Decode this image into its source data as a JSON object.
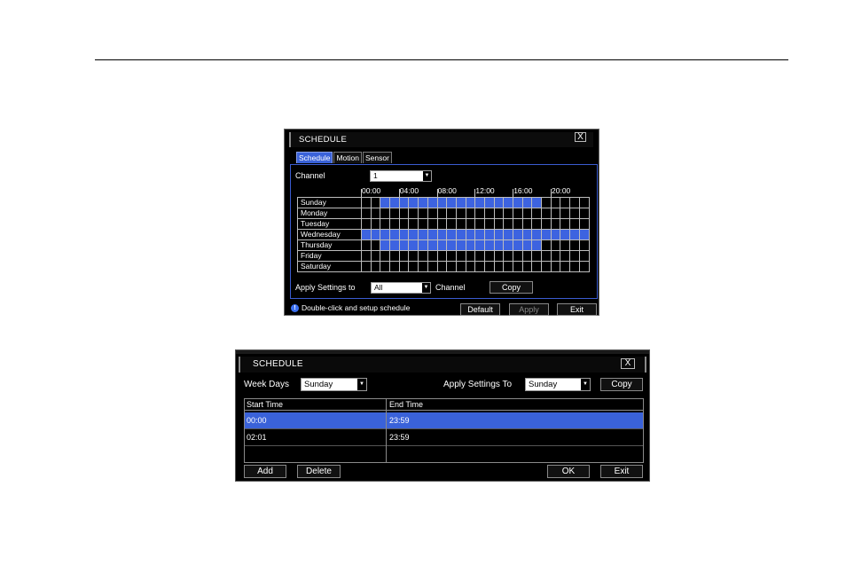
{
  "dialog1": {
    "title": "SCHEDULE",
    "close_glyph": "X",
    "tabs": [
      "Schedule",
      "Motion",
      "Sensor"
    ],
    "active_tab": "Schedule",
    "channel_label": "Channel",
    "channel_value": "1",
    "hours": [
      "00:00",
      "04:00",
      "08:00",
      "12:00",
      "16:00",
      "20:00"
    ],
    "days": [
      "Sunday",
      "Monday",
      "Tuesday",
      "Wednesday",
      "Thursday",
      "Friday",
      "Saturday"
    ],
    "schedule_blocks": [
      [
        2,
        19
      ],
      null,
      null,
      [
        0,
        24
      ],
      [
        2,
        19
      ],
      null,
      null
    ],
    "apply_label": "Apply Settings to",
    "apply_value": "All",
    "apply_suffix": "Channel",
    "copy_label": "Copy",
    "hint_text": "Double-click and setup schedule",
    "default_label": "Default",
    "apply_button_label": "Apply",
    "exit_label": "Exit",
    "colors": {
      "accent": "#3d63e0",
      "background": "#000000"
    }
  },
  "dialog2": {
    "title": "SCHEDULE",
    "close_glyph": "X",
    "weekdays_label": "Week Days",
    "weekdays_value": "Sunday",
    "apply_label": "Apply Settings To",
    "apply_value": "Sunday",
    "copy_label": "Copy",
    "columns": [
      "Start Time",
      "End Time"
    ],
    "rows": [
      {
        "start": "00:00",
        "end": "23:59",
        "selected": true
      },
      {
        "start": "02:01",
        "end": "23:59",
        "selected": false
      }
    ],
    "add_label": "Add",
    "delete_label": "Delete",
    "ok_label": "OK",
    "exit_label": "Exit"
  }
}
